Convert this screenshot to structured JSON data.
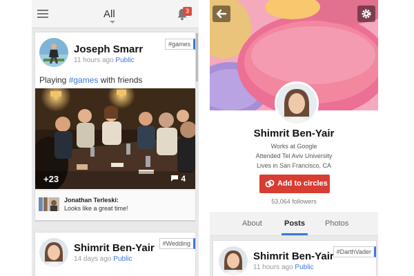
{
  "left": {
    "filter_label": "All",
    "notifications_count": "3",
    "posts": [
      {
        "author": "Joseph Smarr",
        "time": "11 hours ago",
        "visibility": "Public",
        "tag": "#games",
        "text_prefix": "Playing ",
        "text_hashtag": "#games",
        "text_suffix": " with friends",
        "plus_count": "+23",
        "comment_count": "4",
        "comment_author": "Jonathan Terleski:",
        "comment_text": "Looks like a great time!"
      },
      {
        "author": "Shimrit Ben-Yair",
        "time": "14 days ago",
        "visibility": "Public",
        "tag": "#Wedding"
      }
    ]
  },
  "right": {
    "profile": {
      "name": "Shimrit Ben-Yair",
      "work": "Works at Google",
      "education": "Attended Tel Aviv University",
      "location": "Lives in San Francisco, CA",
      "add_button": "Add to circles",
      "followers": "53,064 followers"
    },
    "tabs": [
      {
        "label": "About"
      },
      {
        "label": "Posts"
      },
      {
        "label": "Photos"
      }
    ],
    "active_tab": "Posts",
    "post": {
      "author": "Shimrit Ben-Yair",
      "time": "11 hours ago",
      "visibility": "Public",
      "tag": "#DarthVader"
    }
  },
  "colors": {
    "accent_blue": "#3b78d8",
    "button_red": "#d73d32",
    "badge_red": "#dd4b39"
  },
  "icons": [
    "menu-icon",
    "bell-icon",
    "comment-icon",
    "back-arrow-icon",
    "gear-icon",
    "circles-icon"
  ]
}
